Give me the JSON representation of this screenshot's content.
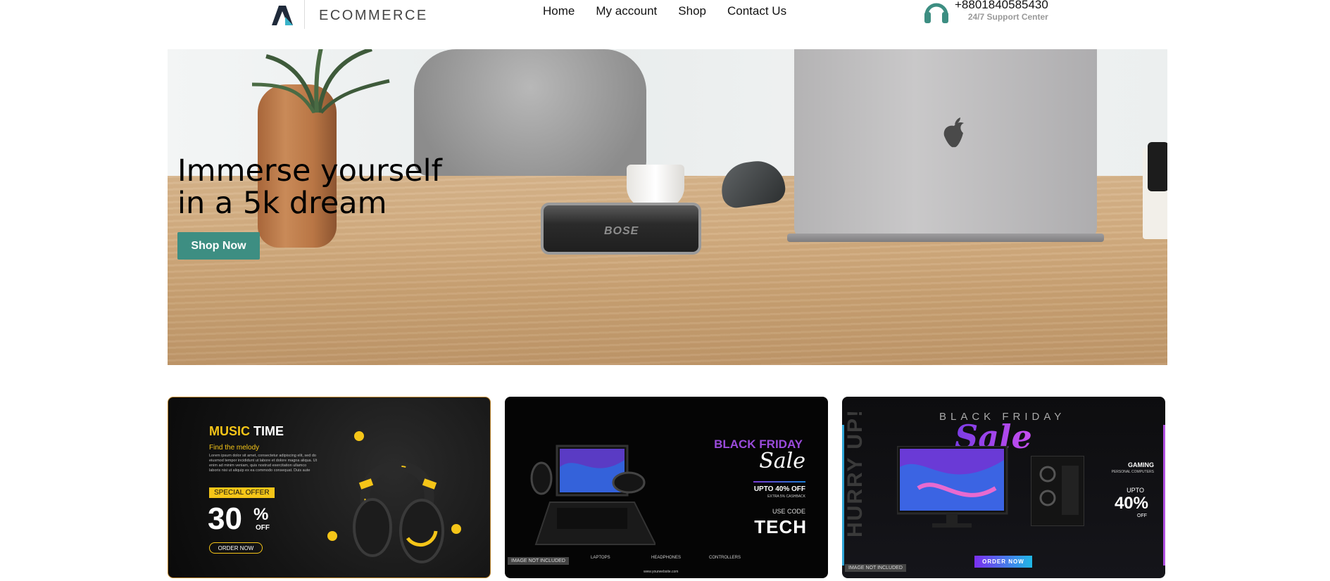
{
  "header": {
    "logo_text": "ECOMMERCE",
    "nav": [
      "Home",
      "My account",
      "Shop",
      "Contact Us"
    ],
    "support_phone": "+8801840585430",
    "support_label": "24/7 Support Center"
  },
  "hero": {
    "title_line1": "Immerse yourself",
    "title_line2": "in a 5k dream",
    "button_label": "Shop Now",
    "speaker_brand": "BOSE"
  },
  "banners": {
    "music": {
      "title_a": "MUSIC",
      "title_b": "TIME",
      "subtitle": "Find the melody",
      "lorem": "Lorem ipsum dolor sit amet, consectetur adipiscing elit, sed do eiusmod tempor incididunt ut labore et dolore magna aliqua. Ut enim ad minim veniam, quis nostrud exercitation ullamco laboris nisi ut aliquip ex ea commodo consequat. Duis aute",
      "special": "SPECIAL OFFER",
      "percent": "30",
      "percent_sign": "%",
      "off": "OFF",
      "order": "ORDER NOW"
    },
    "black_friday": {
      "title": "BLACK FRIDAY",
      "sale": "Sale",
      "upto": "UPTO 40% OFF",
      "cashback": "EXTRA 5% CASHBACK",
      "use_code": "USE CODE",
      "code": "TECH",
      "categories": [
        "LAPTOPS",
        "HEADPHONES",
        "CONTROLLERS"
      ],
      "image_note": "IMAGE NOT INCLUDED",
      "website": "www.yourwebsite.com"
    },
    "gaming": {
      "hurry": "HURRY UP!",
      "title": "BLACK FRIDAY",
      "sale": "Sale",
      "gaming": "GAMING",
      "gaming_sub": "PERSONAL COMPUTERS",
      "upto": "UPTO",
      "percent": "40%",
      "off": "OFF",
      "order": "ORDER NOW",
      "image_note": "IMAGE NOT INCLUDED"
    }
  },
  "colors": {
    "accent": "#3d8e82",
    "music_yellow": "#f5c518",
    "bf_purple": "#9a4bdb"
  }
}
